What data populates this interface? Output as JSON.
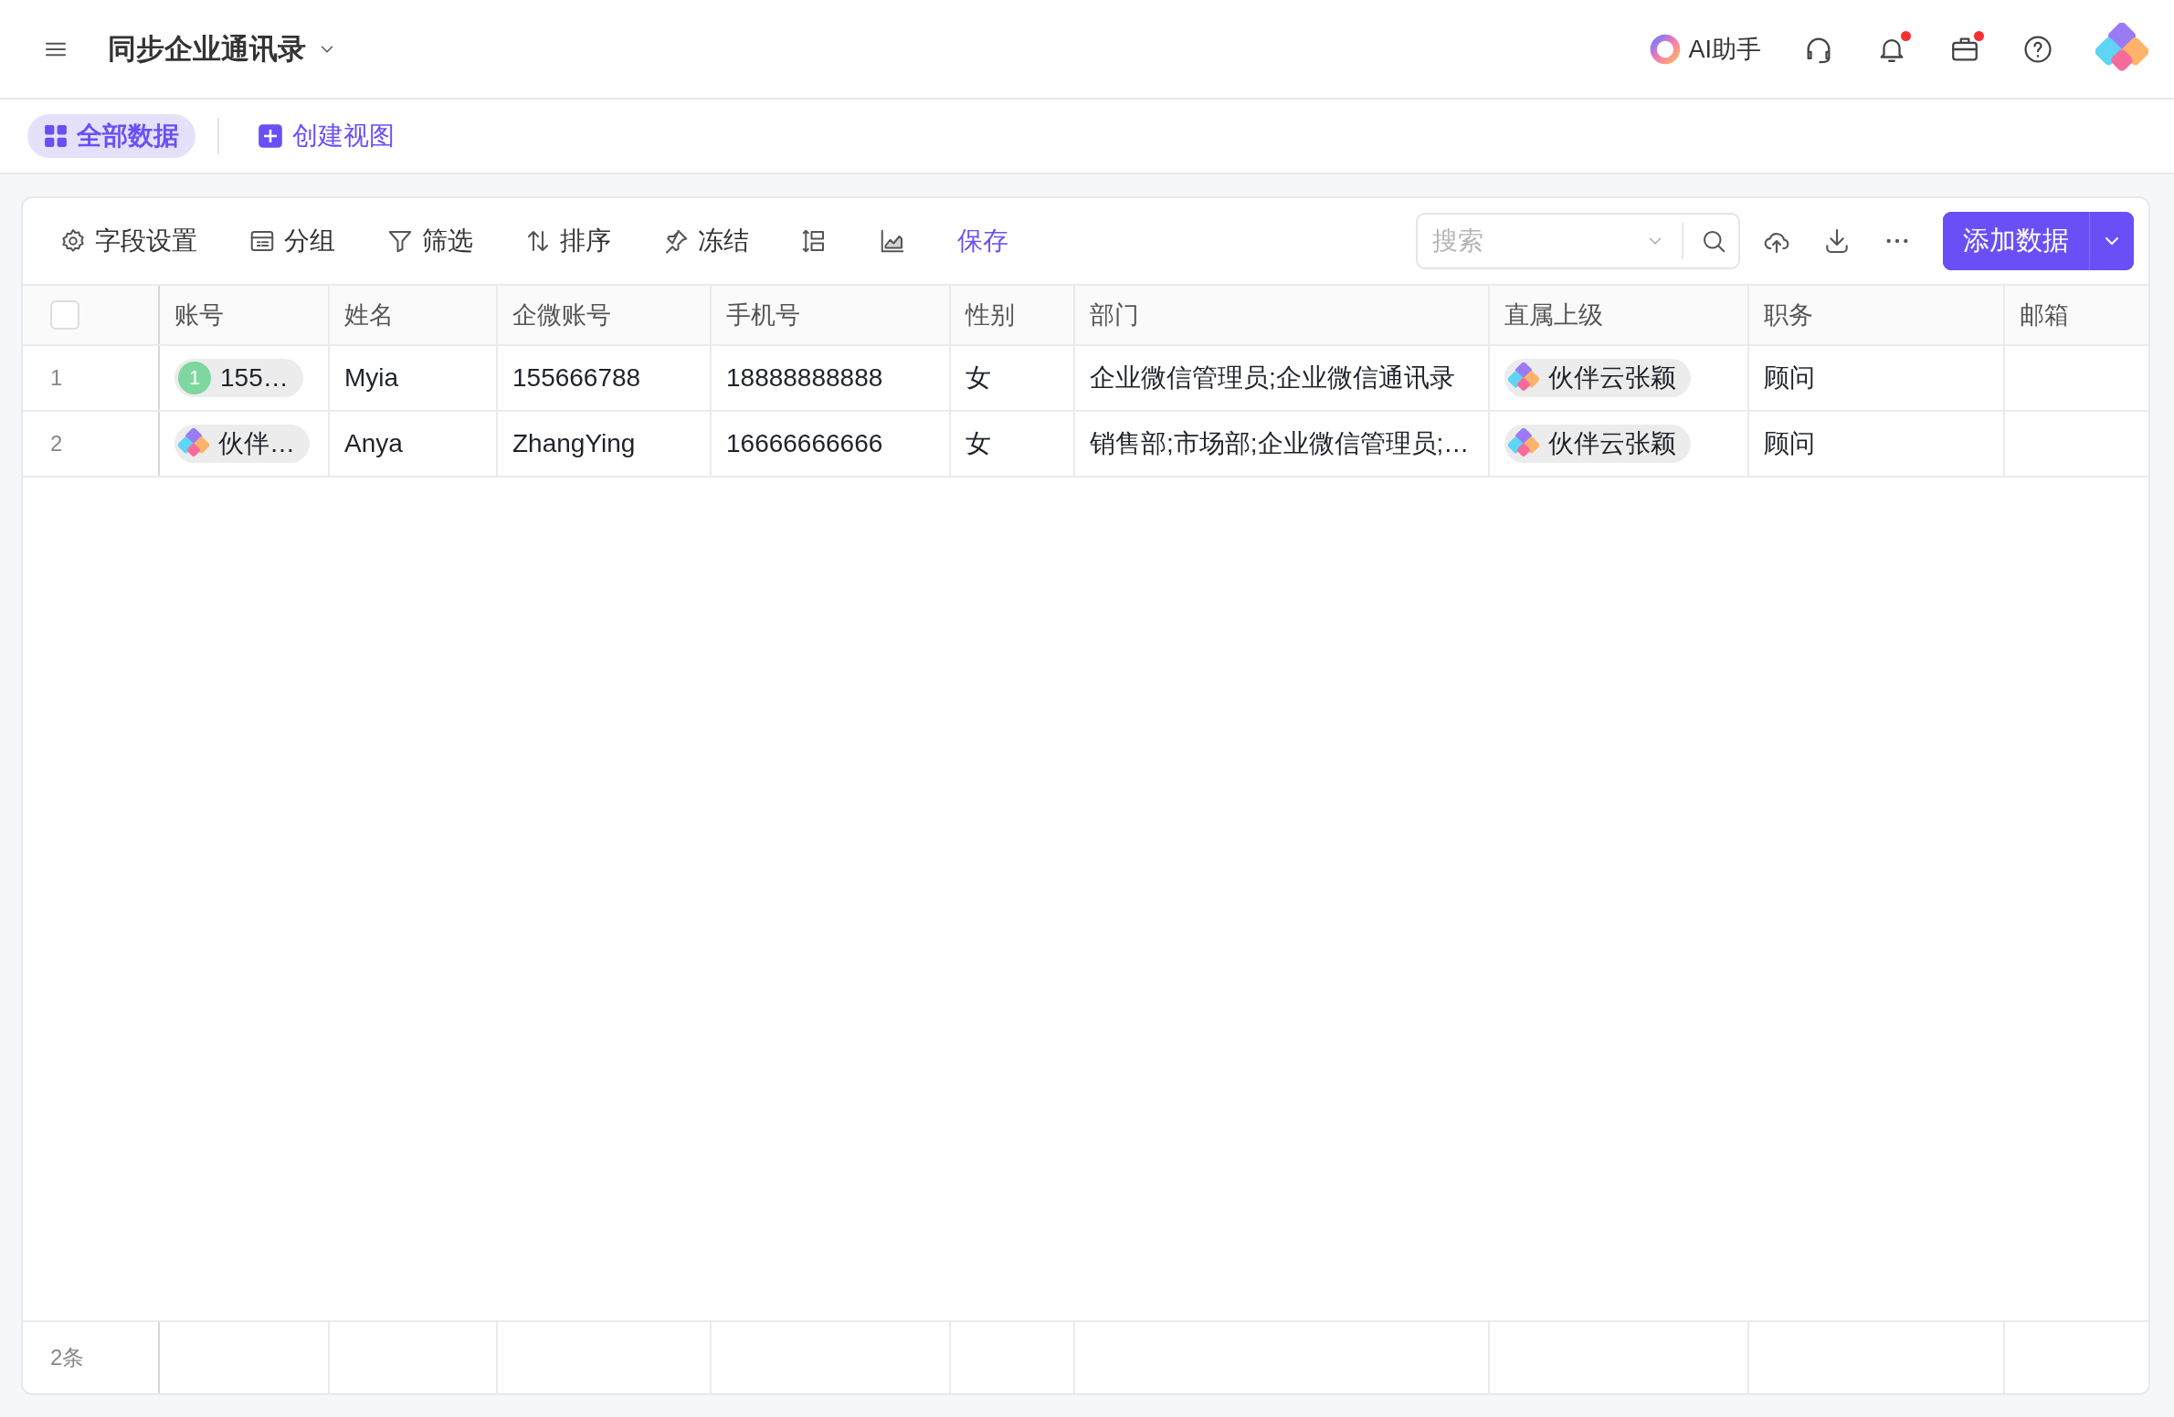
{
  "header": {
    "title": "同步企业通讯录",
    "assistant": "AI助手",
    "bell_badge": true,
    "briefcase_badge": true
  },
  "views": [
    {
      "kind": "view",
      "label": "全部数据",
      "selected": true
    },
    {
      "kind": "action",
      "label": "创建视图",
      "selected": false
    }
  ],
  "toolbar": {
    "items": [
      {
        "kind": "fields",
        "label": "字段设置"
      },
      {
        "kind": "group",
        "label": "分组"
      },
      {
        "kind": "filter",
        "label": "筛选"
      },
      {
        "kind": "sort",
        "label": "排序"
      },
      {
        "kind": "freeze",
        "label": "冻结"
      },
      {
        "kind": "rowheight"
      },
      {
        "kind": "chart"
      },
      {
        "kind": "save",
        "label": "保存"
      }
    ],
    "search": {
      "placeholder": "搜索"
    },
    "add_button": "添加数据"
  },
  "table": {
    "select_all_checked": false,
    "columns": [
      "账号",
      "姓名",
      "企微账号",
      "手机号",
      "性别",
      "部门",
      "直属上级",
      "职务",
      "邮箱"
    ],
    "rows": [
      {
        "index": "1",
        "account": {
          "kind": "number",
          "badge": "1",
          "text": "155…"
        },
        "name": "Myia",
        "wecom_id": "155666788",
        "phone": "18888888888",
        "gender": "女",
        "department": "企业微信管理员;企业微信通讯录",
        "manager": "伙伴云张颖",
        "title": "顾问"
      },
      {
        "index": "2",
        "account": {
          "kind": "logo",
          "text": "伙伴…"
        },
        "name": "Anya",
        "wecom_id": "ZhangYing",
        "phone": "16666666666",
        "gender": "女",
        "department": "销售部;市场部;企业微信管理员;…",
        "manager": "伙伴云张颖",
        "title": "顾问"
      }
    ],
    "footer": "2条"
  }
}
